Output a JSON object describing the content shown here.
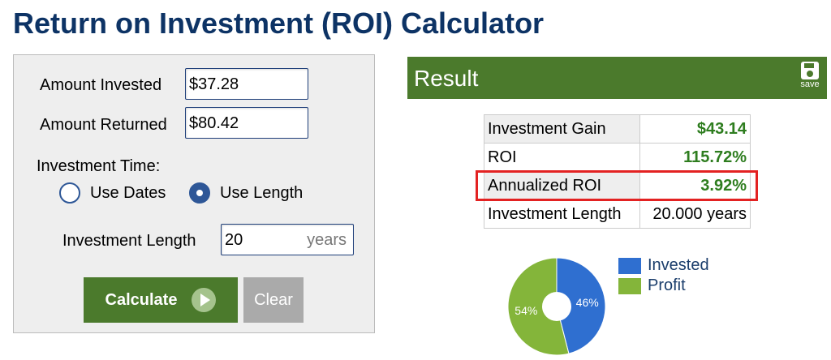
{
  "title": "Return on Investment (ROI) Calculator",
  "form": {
    "amount_invested_label": "Amount Invested",
    "amount_invested_value": "$37.28",
    "amount_returned_label": "Amount Returned",
    "amount_returned_value": "$80.42",
    "investment_time_label": "Investment Time:",
    "radio_use_dates": "Use Dates",
    "radio_use_length": "Use Length",
    "radio_selected": "Use Length",
    "investment_length_label": "Investment Length",
    "investment_length_value": "20",
    "investment_length_unit": "years",
    "calculate_label": "Calculate",
    "clear_label": "Clear"
  },
  "result": {
    "header": "Result",
    "save_label": "save",
    "rows": [
      {
        "label": "Investment Gain",
        "value": "$43.14"
      },
      {
        "label": "ROI",
        "value": "115.72%"
      },
      {
        "label": "Annualized ROI",
        "value": "3.92%"
      },
      {
        "label": "Investment Length",
        "value": "20.000 years"
      }
    ],
    "highlighted_row": "Annualized ROI"
  },
  "chart_data": {
    "type": "pie",
    "series": [
      {
        "name": "Invested",
        "value": 46,
        "label": "46%",
        "color": "#2f6fd0"
      },
      {
        "name": "Profit",
        "value": 54,
        "label": "54%",
        "color": "#84b53a"
      }
    ],
    "donut": true
  },
  "colors": {
    "brand_green": "#4b7a2c",
    "title_blue": "#0d3365",
    "value_green": "#2e7d1f",
    "highlight_red": "#e32222"
  }
}
